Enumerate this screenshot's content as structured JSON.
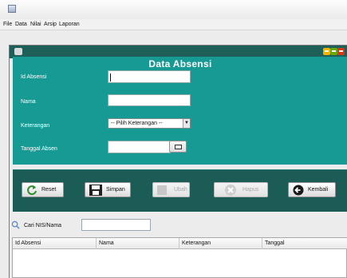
{
  "menu": [
    "File",
    "Data",
    "Nilai",
    "Arsip",
    "Laporan"
  ],
  "form": {
    "title": "Data Absensi",
    "labels": {
      "id": "Id Absensi",
      "nama": "Nama",
      "keterangan": "Keterangan",
      "tanggal": "Tanggal Absen"
    },
    "select_value": "-- Pilih Keterangan --"
  },
  "buttons": {
    "reset": "Reset",
    "simpan": "Simpan",
    "ubah": "Ubah",
    "hapus": "Hapus",
    "kembali": "Kembali"
  },
  "search": {
    "label": "Cari NIS/Nama"
  },
  "table": {
    "columns": [
      "Id Absensi",
      "Nama",
      "Keterangan",
      "Tanggal"
    ]
  },
  "colors": {
    "panel": "#179994",
    "panel_dark": "#1b5c57",
    "titlebar": "#1f5f5a"
  },
  "icons": [
    "app-icon",
    "minimize-icon",
    "maximize-icon",
    "close-icon",
    "refresh-icon",
    "save-icon",
    "edit-icon",
    "delete-icon",
    "back-icon",
    "calendar-icon",
    "search-icon"
  ]
}
